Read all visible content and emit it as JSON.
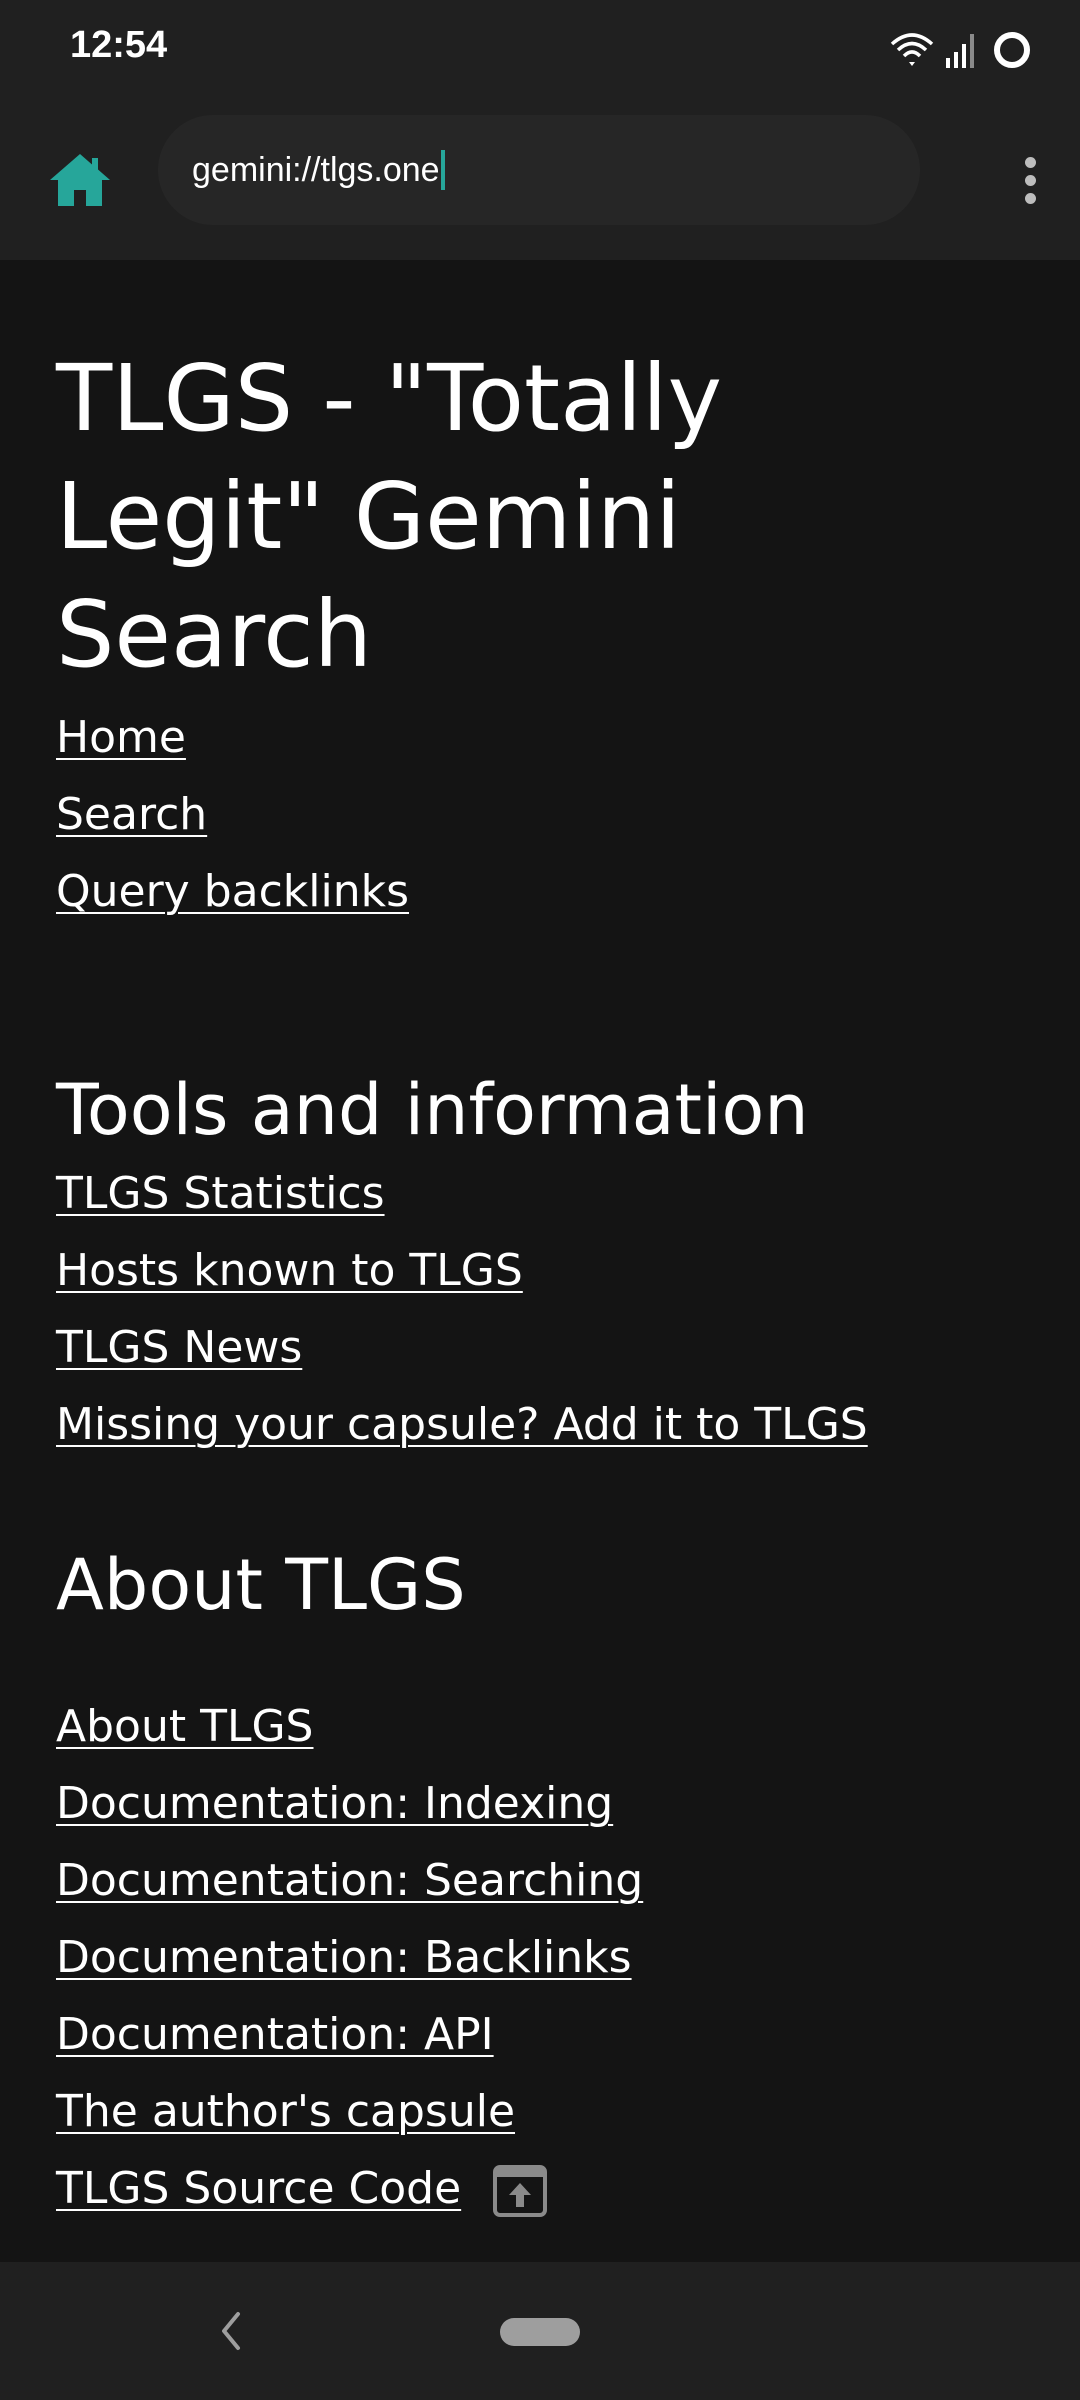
{
  "status_bar": {
    "time": "12:54",
    "icons": [
      "wifi-icon",
      "signal-icon",
      "sync-ring-icon"
    ]
  },
  "toolbar": {
    "home_icon": "home-icon",
    "url": "gemini://tlgs.one",
    "menu_icon": "overflow-menu-icon"
  },
  "colors": {
    "accent": "#26a69a",
    "background": "#141414",
    "bar": "#202020"
  },
  "page": {
    "title": "TLGS - \"Totally Legit\" Gemini Search",
    "nav_links": [
      "Home",
      "Search",
      "Query backlinks"
    ],
    "tools_heading": "Tools and information",
    "tools_links": [
      "TLGS Statistics",
      "Hosts known to TLGS",
      "TLGS News",
      "Missing your capsule? Add it to TLGS"
    ],
    "about_heading": "About TLGS",
    "about_links": [
      "About TLGS",
      "Documentation: Indexing",
      "Documentation: Searching",
      "Documentation: Backlinks",
      "Documentation: API",
      "The author's capsule",
      "TLGS Source Code"
    ],
    "external_link_icon": "open-in-new-icon"
  },
  "nav_bar": {
    "back_icon": "back-chevron-icon",
    "home_pill": "home-pill"
  }
}
